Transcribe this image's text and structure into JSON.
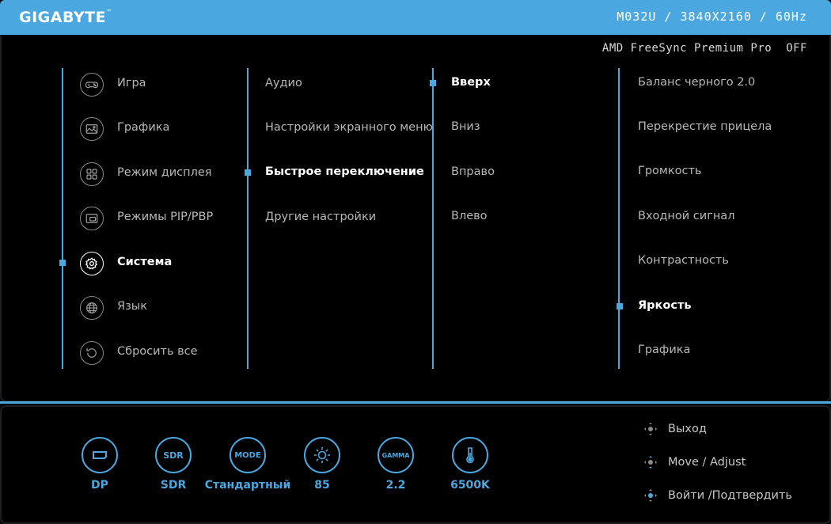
{
  "header": {
    "brand": "GIGABYTE",
    "model_info": "M032U / 3840X2160 / 60Hz"
  },
  "freesync": {
    "label": "AMD FreeSync Premium Pro",
    "value": "OFF"
  },
  "menu_col1": [
    {
      "label": "Игра",
      "icon": "gamepad-icon"
    },
    {
      "label": "Графика",
      "icon": "picture-icon"
    },
    {
      "label": "Режим дисплея",
      "icon": "grid-icon"
    },
    {
      "label": "Режимы PIP/PBP",
      "icon": "pip-icon"
    },
    {
      "label": "Система",
      "icon": "gear-icon",
      "active": true
    },
    {
      "label": "Язык",
      "icon": "globe-icon"
    },
    {
      "label": "Сбросить все",
      "icon": "reset-icon"
    }
  ],
  "menu_col2": [
    {
      "label": "Аудио"
    },
    {
      "label": "Настройки экранного меню"
    },
    {
      "label": "Быстрое переключение",
      "active": true
    },
    {
      "label": "Другие настройки"
    }
  ],
  "menu_col3": [
    {
      "label": "Вверх",
      "active": true
    },
    {
      "label": "Вниз"
    },
    {
      "label": "Вправо"
    },
    {
      "label": "Влево"
    }
  ],
  "menu_col4": [
    {
      "label": "Баланс черного 2.0"
    },
    {
      "label": "Перекрестие прицела"
    },
    {
      "label": "Громкость"
    },
    {
      "label": "Входной сигнал"
    },
    {
      "label": "Контрастность"
    },
    {
      "label": "Яркость",
      "active": true
    },
    {
      "label": "Графика"
    }
  ],
  "status": [
    {
      "icon": "displayport-icon",
      "label": "DP"
    },
    {
      "icon": "sdr-icon",
      "icon_text": "SDR",
      "label": "SDR"
    },
    {
      "icon": "mode-icon",
      "icon_text": "MODE",
      "label": "Стандартный"
    },
    {
      "icon": "brightness-icon",
      "label": "85"
    },
    {
      "icon": "gamma-icon",
      "icon_text": "GAMMA",
      "label": "2.2"
    },
    {
      "icon": "thermometer-icon",
      "label": "6500K"
    }
  ],
  "nav_hints": [
    {
      "label": "Выход"
    },
    {
      "label": "Move / Adjust"
    },
    {
      "label": "Войти /Подтвердить"
    }
  ],
  "colors": {
    "accent": "#4aa7e0",
    "background": "#000000"
  }
}
